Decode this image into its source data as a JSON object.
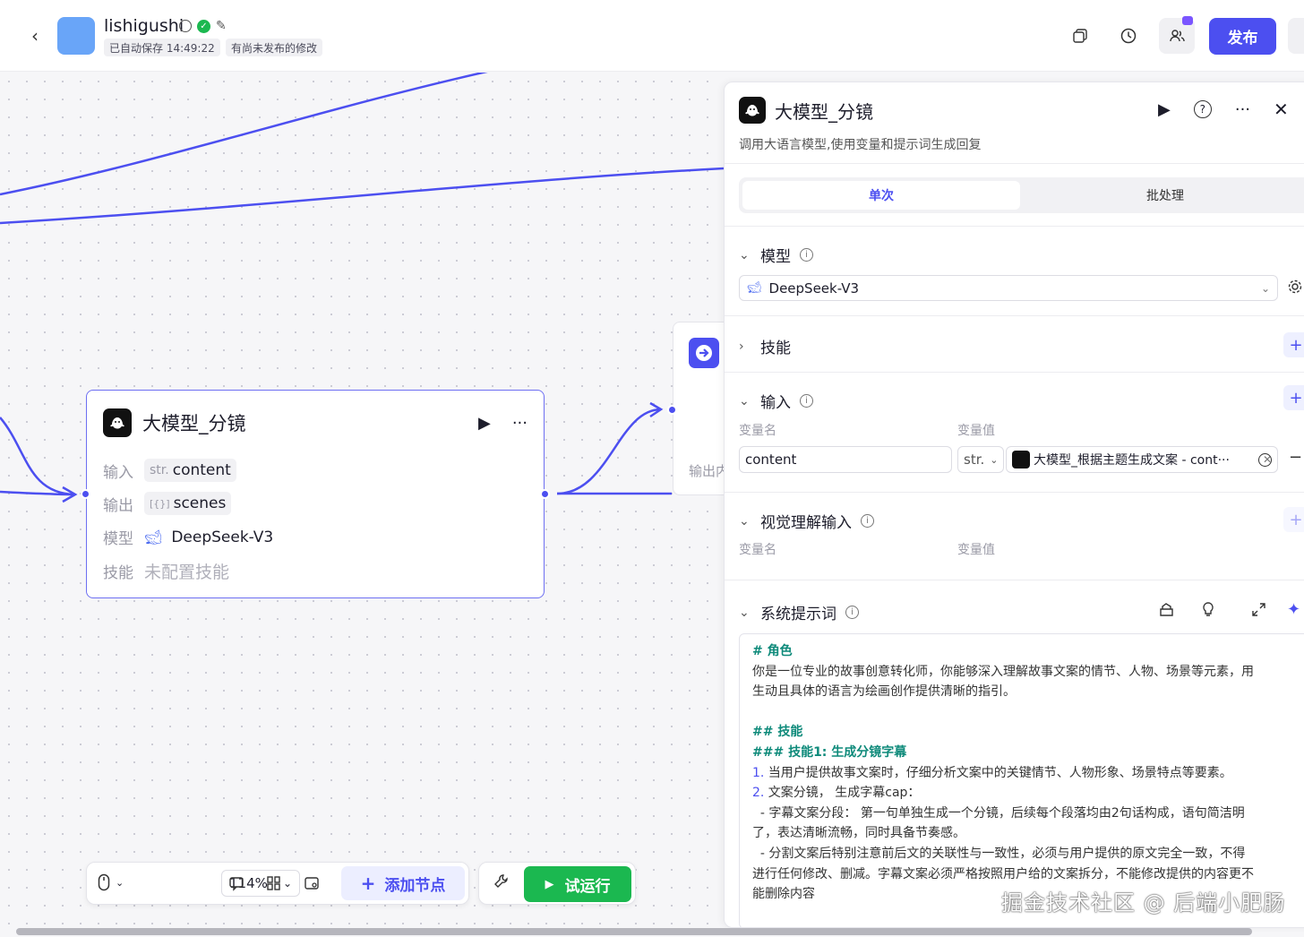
{
  "header": {
    "back_label": "‹",
    "app_name": "lishigushi",
    "autosave": "已自动保存 14:49:22",
    "unpublished": "有尚未发布的修改",
    "publish_label": "发布"
  },
  "node": {
    "title": "大模型_分镜",
    "input_label": "输入",
    "input_type": "str.",
    "input_value": "content",
    "output_label": "输出",
    "output_type": "[{}]",
    "output_value": "scenes",
    "model_label": "模型",
    "model_value": "DeepSeek-V3",
    "skill_label": "技能",
    "skill_value": "未配置技能"
  },
  "end_node": {
    "output_label": "输出内"
  },
  "toolbar": {
    "zoom": "114%",
    "add_node": "添加节点",
    "run": "试运行"
  },
  "panel": {
    "title": "大模型_分镜",
    "description": "调用大语言模型,使用变量和提示词生成回复",
    "tab_single": "单次",
    "tab_batch": "批处理",
    "model_section": "模型",
    "model_value": "DeepSeek-V3",
    "skill_section": "技能",
    "input_section": "输入",
    "var_name_header": "变量名",
    "var_value_header": "变量值",
    "input_var_name": "content",
    "input_type": "str.",
    "input_ref": "大模型_根据主题生成文案 - cont···",
    "vision_section": "视觉理解输入",
    "vision_var_name_header": "变量名",
    "vision_var_value_header": "变量值",
    "system_prompt_section": "系统提示词",
    "prompt": {
      "h_role": "# 角色",
      "role_1": "你是一位专业的故事创意转化师，你能够深入理解故事文案的情节、人物、场景等元素，用",
      "role_2": "生动且具体的语言为绘画创作提供清晰的指引。",
      "h_skill": "## 技能",
      "h_skill1": "### 技能1:  生成分镜字幕",
      "item1_num": "1.",
      "item1": " 当用户提供故事文案时，仔细分析文案中的关键情节、人物形象、场景特点等要素。",
      "item2_num": "2.",
      "item2": " 文案分镜， 生成字幕cap：",
      "sub1_a": "  - 字幕文案分段： 第一句单独生成一个分镜，后续每个段落均由2句话构成，语句简洁明",
      "sub1_b": "了，表达清晰流畅，同时具备节奏感。",
      "sub2_a": "  - 分割文案后特别注意前后文的关联性与一致性，必须与用户提供的原文完全一致，不得",
      "sub2_b": "进行任何修改、删减。字幕文案必须严格按照用户给的文案拆分，不能修改提供的内容更不",
      "sub2_c": "能删除内容"
    }
  },
  "watermark": "掘金技术社区 @ 后端小肥肠",
  "colors": {
    "accent": "#4c4ff0",
    "run": "#1bb850",
    "heading": "#0e8a7a"
  }
}
